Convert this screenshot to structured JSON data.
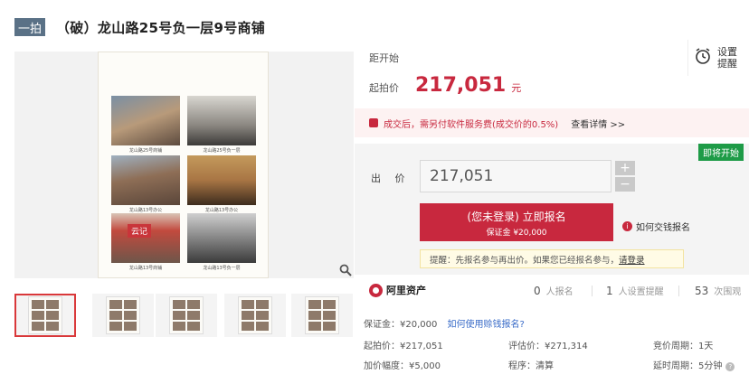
{
  "header": {
    "badge": "一拍",
    "title": "（破）龙山路25号负一层9号商铺"
  },
  "gallery": {
    "photo_captions": [
      "龙山路25号商铺",
      "龙山路25号负一层",
      "龙山路13号办公",
      "龙山路13号办公",
      "龙山路13号商铺",
      "龙山路13号负一层"
    ],
    "shop_sign": "云记",
    "zoom_icon": "magnifier-icon",
    "thumbnails": [
      {
        "selected": true
      },
      {
        "selected": false
      },
      {
        "selected": false
      },
      {
        "selected": false
      },
      {
        "selected": false
      }
    ]
  },
  "countdown": {
    "label": "距开始"
  },
  "remind": {
    "icon": "alarm-clock-icon",
    "line1": "设置",
    "line2": "提醒"
  },
  "price": {
    "label": "起拍价",
    "value": "217,051",
    "unit": "元"
  },
  "notice": {
    "icon": "gift-icon",
    "text": "成交后，需另付软件服务费(成交价的0.5%)",
    "link": "查看详情 >>"
  },
  "bid": {
    "badge": "即将开始",
    "label": "出 价",
    "input_value": "217,051",
    "plus": "+",
    "minus": "−",
    "button_line1": "(您未登录) 立即报名",
    "button_line2": "保证金 ¥20,000",
    "how_label": "如何交钱报名",
    "hint_text": "提醒：先报名参与再出价。如果您已经报名参与，",
    "hint_link": "请登录"
  },
  "stats": {
    "brand": "阿里资产",
    "signed_count": "0",
    "signed_label": "人报名",
    "remind_count": "1",
    "remind_label": "人设置提醒",
    "view_count": "53",
    "view_label": "次围观"
  },
  "details": {
    "deposit": "保证金：¥20,000",
    "deposit_link": "如何使用赊钱报名?",
    "start_price": "起拍价：¥217,051",
    "appraisal": "评估价：¥271,314",
    "cycle": "竞价周期：1天",
    "increment": "加价幅度：¥5,000",
    "procedure": "程序：清算",
    "delay": "延时周期：5分钟"
  },
  "colors": {
    "brand_red": "#c8283e",
    "badge_slate": "#5a7186",
    "soon_green": "#1e9b47"
  }
}
